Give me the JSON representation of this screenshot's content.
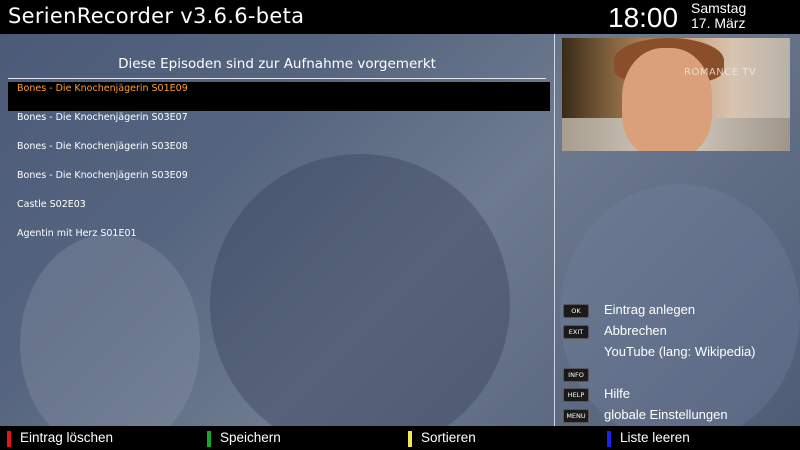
{
  "header": {
    "title": "SerienRecorder v3.6.6-beta",
    "time": "18:00",
    "weekday": "Samstag",
    "date": "17. März"
  },
  "list": {
    "title": "Diese Episoden sind zur Aufnahme vorgemerkt",
    "items": [
      {
        "label": "Bones - Die Knochenjägerin S01E09",
        "selected": true
      },
      {
        "label": "Bones - Die Knochenjägerin S03E07",
        "selected": false
      },
      {
        "label": "Bones - Die Knochenjägerin S03E08",
        "selected": false
      },
      {
        "label": "Bones - Die Knochenjägerin S03E09",
        "selected": false
      },
      {
        "label": "Castle S02E03",
        "selected": false
      },
      {
        "label": "Agentin mit Herz S01E01",
        "selected": false
      }
    ]
  },
  "preview": {
    "channel_logo": "ROMANCE TV"
  },
  "keys": [
    {
      "key": "OK",
      "label": "Eintrag anlegen"
    },
    {
      "key": "EXIT",
      "label": "Abbrechen"
    },
    {
      "key": "",
      "label": "YouTube (lang: Wikipedia)"
    },
    {
      "key": "INFO",
      "label": ""
    },
    {
      "key": "HELP",
      "label": "Hilfe"
    },
    {
      "key": "MENU",
      "label": "globale Einstellungen"
    }
  ],
  "footer": {
    "red": {
      "label": "Eintrag löschen",
      "color": "#e8141b"
    },
    "green": {
      "label": "Speichern",
      "color": "#19a531"
    },
    "yellow": {
      "label": "Sortieren",
      "color": "#efe85a"
    },
    "blue": {
      "label": "Liste leeren",
      "color": "#1b23e8"
    }
  },
  "colors": {
    "selected_text": "#ff9d2e",
    "background": "#55637e"
  }
}
